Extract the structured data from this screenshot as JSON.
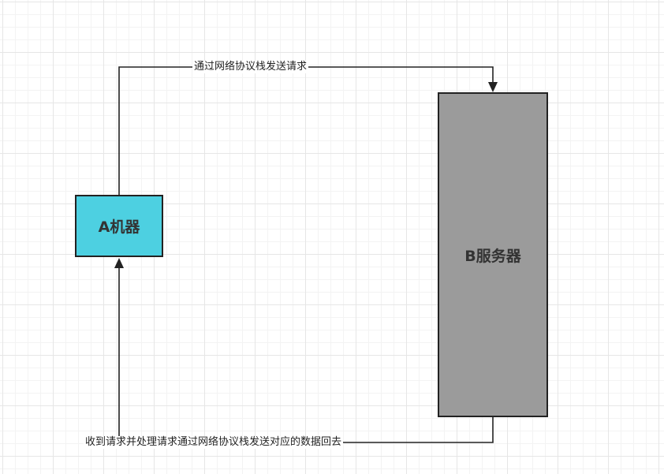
{
  "nodes": {
    "machine_a": {
      "label": "A机器",
      "fill": "#4dd0e1"
    },
    "server_b": {
      "label": "B服务器",
      "fill": "#9b9b9b"
    }
  },
  "edges": {
    "request": {
      "label": "通过网络协议栈发送请求"
    },
    "response": {
      "label": "收到请求并处理请求通过网络协议栈发送对应的数据回去"
    }
  },
  "colors": {
    "stroke": "#222222",
    "grid": "#e6e6e6"
  }
}
